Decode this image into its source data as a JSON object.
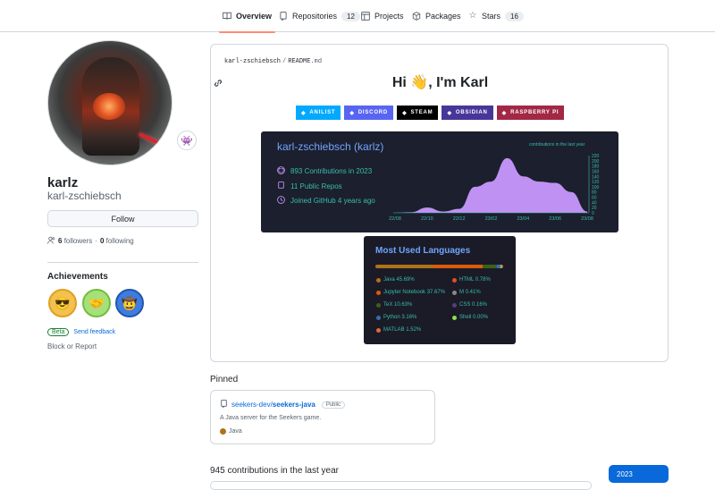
{
  "nav": {
    "tabs": [
      {
        "label": "Overview",
        "icon": "book-icon"
      },
      {
        "label": "Repositories",
        "icon": "repo-icon",
        "count": "12"
      },
      {
        "label": "Projects",
        "icon": "table-icon"
      },
      {
        "label": "Packages",
        "icon": "package-icon"
      },
      {
        "label": "Stars",
        "icon": "star-icon",
        "count": "16"
      }
    ]
  },
  "profile": {
    "name": "karlz",
    "login": "karl-zschiebsch",
    "follow_label": "Follow",
    "followers_count": "6",
    "followers_label": "followers",
    "separator": "·",
    "following_count": "0",
    "following_label": "following",
    "achievements_title": "Achievements",
    "beta_label": "Beta",
    "feedback_label": "Send feedback",
    "block_label": "Block or Report"
  },
  "readme": {
    "owner": "karl-zschiebsch",
    "sep": "/",
    "file": "README",
    "ext": ".md",
    "greeting": "Hi 👋, I'm Karl",
    "shields": [
      {
        "label": "ANILIST",
        "color": "#02a9ff"
      },
      {
        "label": "DISCORD",
        "color": "#5865f2"
      },
      {
        "label": "STEAM",
        "color": "#000000"
      },
      {
        "label": "OBSIDIAN",
        "color": "#483699"
      },
      {
        "label": "RASPBERRY PI",
        "color": "#a22846"
      }
    ],
    "stats_card": {
      "title": "karl-zschiebsch (karlz)",
      "contributions": "893 Contributions in 2023",
      "repos": "11 Public Repos",
      "joined": "Joined GitHub 4 years ago",
      "chart_title": "contributions in the last year"
    },
    "languages_card": {
      "title": "Most Used Languages",
      "items": [
        {
          "label": "Java 45.69%",
          "color": "#b07219"
        },
        {
          "label": "HTML 0.78%",
          "color": "#e34c26"
        },
        {
          "label": "Jupyter Notebook 37.67%",
          "color": "#da5b0b"
        },
        {
          "label": "M 0.41%",
          "color": "#8a8a8a"
        },
        {
          "label": "TeX 10.63%",
          "color": "#3d6117"
        },
        {
          "label": "CSS 0.16%",
          "color": "#563d7c"
        },
        {
          "label": "Python 3.16%",
          "color": "#3572a5"
        },
        {
          "label": "Shell 0.00%",
          "color": "#89e051"
        },
        {
          "label": "MATLAB 1.52%",
          "color": "#e16737"
        }
      ]
    }
  },
  "chart_data": {
    "type": "area",
    "title": "contributions in the last year",
    "x_ticks": [
      "22/08",
      "22/10",
      "22/12",
      "23/02",
      "23/04",
      "23/06",
      "23/08"
    ],
    "y_ticks": [
      "0",
      "20",
      "40",
      "60",
      "80",
      "100",
      "120",
      "140",
      "160",
      "180",
      "200",
      "220"
    ],
    "ylim": [
      0,
      220
    ],
    "x": [
      "22/08",
      "22/09",
      "22/10",
      "22/11",
      "22/12",
      "23/01",
      "23/02",
      "23/03",
      "23/04",
      "23/05",
      "23/06",
      "23/07",
      "23/08"
    ],
    "values": [
      0,
      2,
      20,
      5,
      15,
      100,
      120,
      210,
      140,
      120,
      115,
      80,
      5
    ],
    "color": "#bf91f3"
  },
  "pinned": {
    "title": "Pinned",
    "repo": {
      "owner": "seekers-dev/",
      "name": "seekers-java",
      "visibility": "Public",
      "description": "A Java server for the Seekers game.",
      "language": "Java",
      "language_color": "#b07219"
    }
  },
  "contributions": {
    "title": "945 contributions in the last year",
    "year": "2023"
  }
}
